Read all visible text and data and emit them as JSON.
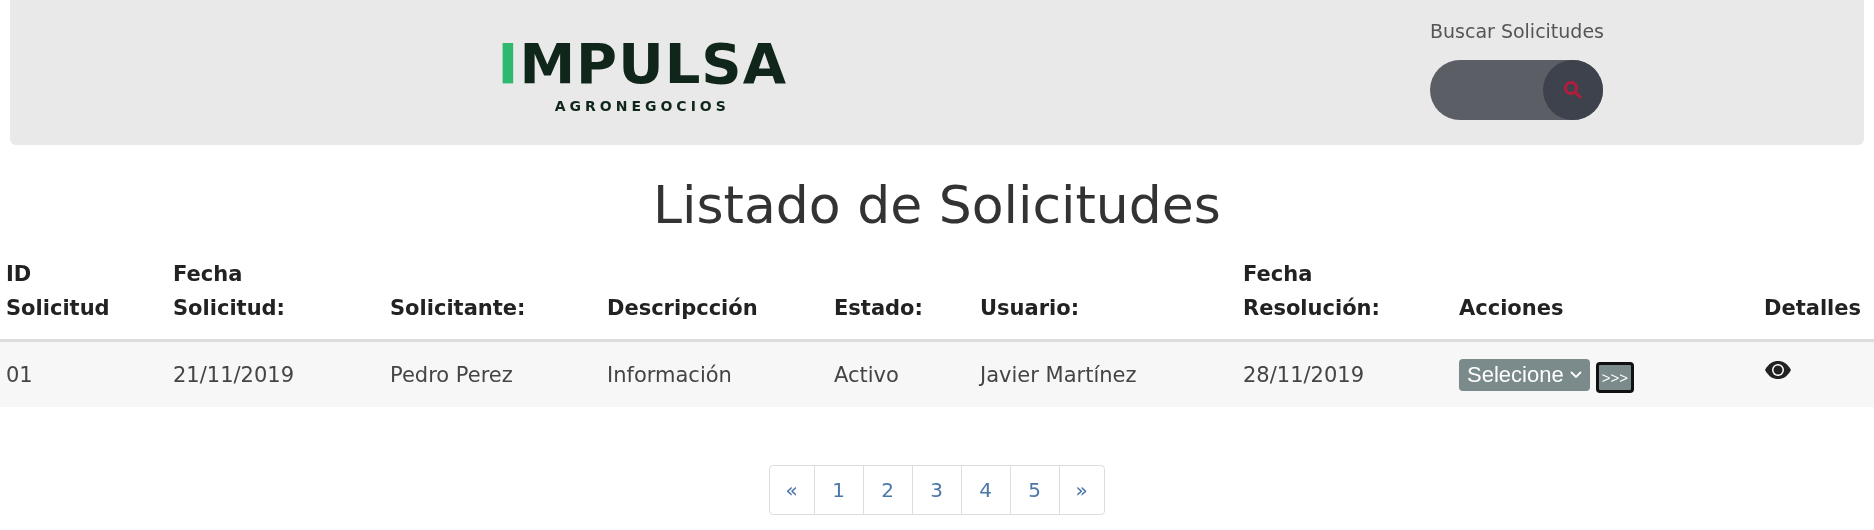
{
  "header": {
    "logo": {
      "name": "IMPULSA",
      "tagline": "AGRONEGOCIOS"
    },
    "search": {
      "label": "Buscar Solicitudes"
    }
  },
  "title": "Listado de Solicitudes",
  "table": {
    "columns": [
      "ID\nSolicitud",
      "Fecha\nSolicitud:",
      "Solicitante:",
      "Descripcción",
      "Estado:",
      "Usuario:",
      "Fecha\nResolución:",
      "Acciones",
      "Detalles"
    ],
    "rows": [
      {
        "cells": [
          "01",
          "21/11/2019",
          "Pedro Perez",
          "Información",
          "Activo",
          "Javier Martínez",
          "28/11/2019"
        ],
        "action_select": "Selecione",
        "action_button": ">>>"
      }
    ]
  },
  "pagination": [
    "«",
    "1",
    "2",
    "3",
    "4",
    "5",
    "»"
  ]
}
